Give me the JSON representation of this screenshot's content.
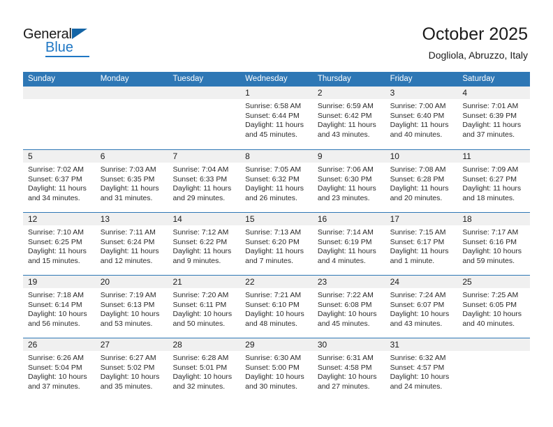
{
  "brand": {
    "name_part1": "General",
    "name_part2": "Blue"
  },
  "header": {
    "title": "October 2025",
    "location": "Dogliola, Abruzzo, Italy"
  },
  "colors": {
    "header_blue": "#2e77b5",
    "brand_blue": "#1f77c4",
    "cell_head_gray": "#f0f0f0"
  },
  "weekdays": [
    "Sunday",
    "Monday",
    "Tuesday",
    "Wednesday",
    "Thursday",
    "Friday",
    "Saturday"
  ],
  "weeks": [
    [
      {
        "day": ""
      },
      {
        "day": ""
      },
      {
        "day": ""
      },
      {
        "day": "1",
        "sunrise": "Sunrise: 6:58 AM",
        "sunset": "Sunset: 6:44 PM",
        "daylight1": "Daylight: 11 hours",
        "daylight2": "and 45 minutes."
      },
      {
        "day": "2",
        "sunrise": "Sunrise: 6:59 AM",
        "sunset": "Sunset: 6:42 PM",
        "daylight1": "Daylight: 11 hours",
        "daylight2": "and 43 minutes."
      },
      {
        "day": "3",
        "sunrise": "Sunrise: 7:00 AM",
        "sunset": "Sunset: 6:40 PM",
        "daylight1": "Daylight: 11 hours",
        "daylight2": "and 40 minutes."
      },
      {
        "day": "4",
        "sunrise": "Sunrise: 7:01 AM",
        "sunset": "Sunset: 6:39 PM",
        "daylight1": "Daylight: 11 hours",
        "daylight2": "and 37 minutes."
      }
    ],
    [
      {
        "day": "5",
        "sunrise": "Sunrise: 7:02 AM",
        "sunset": "Sunset: 6:37 PM",
        "daylight1": "Daylight: 11 hours",
        "daylight2": "and 34 minutes."
      },
      {
        "day": "6",
        "sunrise": "Sunrise: 7:03 AM",
        "sunset": "Sunset: 6:35 PM",
        "daylight1": "Daylight: 11 hours",
        "daylight2": "and 31 minutes."
      },
      {
        "day": "7",
        "sunrise": "Sunrise: 7:04 AM",
        "sunset": "Sunset: 6:33 PM",
        "daylight1": "Daylight: 11 hours",
        "daylight2": "and 29 minutes."
      },
      {
        "day": "8",
        "sunrise": "Sunrise: 7:05 AM",
        "sunset": "Sunset: 6:32 PM",
        "daylight1": "Daylight: 11 hours",
        "daylight2": "and 26 minutes."
      },
      {
        "day": "9",
        "sunrise": "Sunrise: 7:06 AM",
        "sunset": "Sunset: 6:30 PM",
        "daylight1": "Daylight: 11 hours",
        "daylight2": "and 23 minutes."
      },
      {
        "day": "10",
        "sunrise": "Sunrise: 7:08 AM",
        "sunset": "Sunset: 6:28 PM",
        "daylight1": "Daylight: 11 hours",
        "daylight2": "and 20 minutes."
      },
      {
        "day": "11",
        "sunrise": "Sunrise: 7:09 AM",
        "sunset": "Sunset: 6:27 PM",
        "daylight1": "Daylight: 11 hours",
        "daylight2": "and 18 minutes."
      }
    ],
    [
      {
        "day": "12",
        "sunrise": "Sunrise: 7:10 AM",
        "sunset": "Sunset: 6:25 PM",
        "daylight1": "Daylight: 11 hours",
        "daylight2": "and 15 minutes."
      },
      {
        "day": "13",
        "sunrise": "Sunrise: 7:11 AM",
        "sunset": "Sunset: 6:24 PM",
        "daylight1": "Daylight: 11 hours",
        "daylight2": "and 12 minutes."
      },
      {
        "day": "14",
        "sunrise": "Sunrise: 7:12 AM",
        "sunset": "Sunset: 6:22 PM",
        "daylight1": "Daylight: 11 hours",
        "daylight2": "and 9 minutes."
      },
      {
        "day": "15",
        "sunrise": "Sunrise: 7:13 AM",
        "sunset": "Sunset: 6:20 PM",
        "daylight1": "Daylight: 11 hours",
        "daylight2": "and 7 minutes."
      },
      {
        "day": "16",
        "sunrise": "Sunrise: 7:14 AM",
        "sunset": "Sunset: 6:19 PM",
        "daylight1": "Daylight: 11 hours",
        "daylight2": "and 4 minutes."
      },
      {
        "day": "17",
        "sunrise": "Sunrise: 7:15 AM",
        "sunset": "Sunset: 6:17 PM",
        "daylight1": "Daylight: 11 hours",
        "daylight2": "and 1 minute."
      },
      {
        "day": "18",
        "sunrise": "Sunrise: 7:17 AM",
        "sunset": "Sunset: 6:16 PM",
        "daylight1": "Daylight: 10 hours",
        "daylight2": "and 59 minutes."
      }
    ],
    [
      {
        "day": "19",
        "sunrise": "Sunrise: 7:18 AM",
        "sunset": "Sunset: 6:14 PM",
        "daylight1": "Daylight: 10 hours",
        "daylight2": "and 56 minutes."
      },
      {
        "day": "20",
        "sunrise": "Sunrise: 7:19 AM",
        "sunset": "Sunset: 6:13 PM",
        "daylight1": "Daylight: 10 hours",
        "daylight2": "and 53 minutes."
      },
      {
        "day": "21",
        "sunrise": "Sunrise: 7:20 AM",
        "sunset": "Sunset: 6:11 PM",
        "daylight1": "Daylight: 10 hours",
        "daylight2": "and 50 minutes."
      },
      {
        "day": "22",
        "sunrise": "Sunrise: 7:21 AM",
        "sunset": "Sunset: 6:10 PM",
        "daylight1": "Daylight: 10 hours",
        "daylight2": "and 48 minutes."
      },
      {
        "day": "23",
        "sunrise": "Sunrise: 7:22 AM",
        "sunset": "Sunset: 6:08 PM",
        "daylight1": "Daylight: 10 hours",
        "daylight2": "and 45 minutes."
      },
      {
        "day": "24",
        "sunrise": "Sunrise: 7:24 AM",
        "sunset": "Sunset: 6:07 PM",
        "daylight1": "Daylight: 10 hours",
        "daylight2": "and 43 minutes."
      },
      {
        "day": "25",
        "sunrise": "Sunrise: 7:25 AM",
        "sunset": "Sunset: 6:05 PM",
        "daylight1": "Daylight: 10 hours",
        "daylight2": "and 40 minutes."
      }
    ],
    [
      {
        "day": "26",
        "sunrise": "Sunrise: 6:26 AM",
        "sunset": "Sunset: 5:04 PM",
        "daylight1": "Daylight: 10 hours",
        "daylight2": "and 37 minutes."
      },
      {
        "day": "27",
        "sunrise": "Sunrise: 6:27 AM",
        "sunset": "Sunset: 5:02 PM",
        "daylight1": "Daylight: 10 hours",
        "daylight2": "and 35 minutes."
      },
      {
        "day": "28",
        "sunrise": "Sunrise: 6:28 AM",
        "sunset": "Sunset: 5:01 PM",
        "daylight1": "Daylight: 10 hours",
        "daylight2": "and 32 minutes."
      },
      {
        "day": "29",
        "sunrise": "Sunrise: 6:30 AM",
        "sunset": "Sunset: 5:00 PM",
        "daylight1": "Daylight: 10 hours",
        "daylight2": "and 30 minutes."
      },
      {
        "day": "30",
        "sunrise": "Sunrise: 6:31 AM",
        "sunset": "Sunset: 4:58 PM",
        "daylight1": "Daylight: 10 hours",
        "daylight2": "and 27 minutes."
      },
      {
        "day": "31",
        "sunrise": "Sunrise: 6:32 AM",
        "sunset": "Sunset: 4:57 PM",
        "daylight1": "Daylight: 10 hours",
        "daylight2": "and 24 minutes."
      },
      {
        "day": ""
      }
    ]
  ]
}
